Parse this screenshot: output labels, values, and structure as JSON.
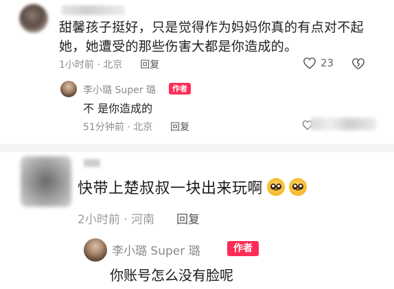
{
  "comment1": {
    "text": "甜馨孩子挺好，只是觉得作为妈妈你真的有点对不起她，她遭受的那些伤害大都是你造成的。",
    "meta": "1小时前 · 北京",
    "reply_label": "回复",
    "like_count": "23",
    "reply": {
      "author": "李小璐 Super 璐",
      "badge": "作者",
      "text": "不 是你造成的",
      "meta": "51分钟前 · 北京",
      "reply_label": "回复"
    }
  },
  "comment2": {
    "text": "快带上楚叔叔一块出来玩啊",
    "emoji": [
      "pleading-face",
      "pleading-face"
    ],
    "meta": "2小时前 · 河南",
    "reply_label": "回复",
    "reply": {
      "author": "李小璐 Super 璐",
      "badge": "作者",
      "text": "你账号怎么没有脸呢"
    }
  },
  "colors": {
    "badge": "#fe2c55",
    "meta": "#8c8c8c",
    "divider": "#f3f3f3"
  }
}
